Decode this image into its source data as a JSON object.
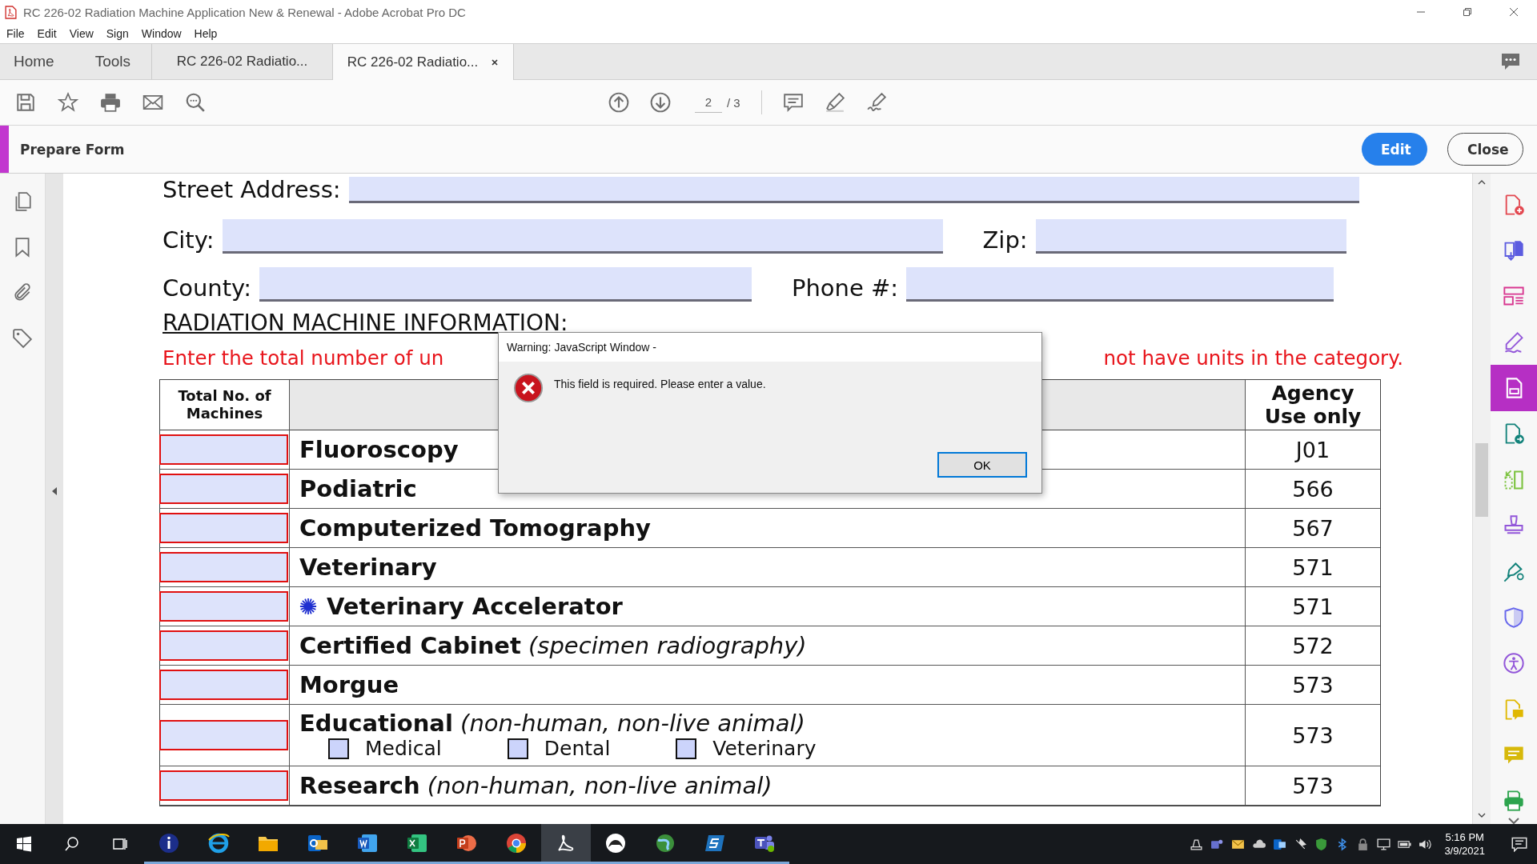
{
  "window": {
    "title": "RC 226-02 Radiation Machine Application New & Renewal - Adobe Acrobat Pro DC"
  },
  "menu": [
    "File",
    "Edit",
    "View",
    "Sign",
    "Window",
    "Help"
  ],
  "nav": [
    "Home",
    "Tools"
  ],
  "tabs": [
    {
      "label": "RC 226-02 Radiatio...",
      "selected": false
    },
    {
      "label": "RC 226-02 Radiatio...",
      "selected": true
    }
  ],
  "toolbar": {
    "page": "2",
    "page_count": "/ 3"
  },
  "panel": {
    "title": "Prepare Form",
    "buttons": [
      {
        "label": "Edit",
        "kind": "primary"
      },
      {
        "label": "Close",
        "kind": "secondary"
      }
    ]
  },
  "right_tools": [
    {
      "kind": "doc-plus",
      "selected": false
    },
    {
      "kind": "doc-down",
      "selected": false
    },
    {
      "kind": "layout",
      "selected": false
    },
    {
      "kind": "pen",
      "selected": false
    },
    {
      "kind": "form",
      "selected": true
    },
    {
      "kind": "doc-arrow",
      "selected": false
    },
    {
      "kind": "crop",
      "selected": false
    },
    {
      "kind": "stamp",
      "selected": false
    },
    {
      "kind": "nib",
      "selected": false
    },
    {
      "kind": "shield",
      "selected": false
    },
    {
      "kind": "access",
      "selected": false
    },
    {
      "kind": "doc-comment",
      "selected": false
    },
    {
      "kind": "comment",
      "selected": false
    },
    {
      "kind": "printer",
      "selected": false
    }
  ],
  "field_rows": [
    {
      "fields": [
        {
          "label": "Street Address:"
        }
      ]
    },
    {
      "fields": [
        {
          "label": "City:"
        },
        {
          "label": "Zip:"
        }
      ]
    },
    {
      "fields": [
        {
          "label": "County:"
        },
        {
          "label": "Phone #:"
        }
      ]
    }
  ],
  "section_heading": "RADIATION MACHINE INFORMATION:",
  "instruction": [
    "Enter the total number of un",
    "not have units in the category."
  ],
  "table": {
    "count_header": "Total No. of Machines",
    "code_header": "Agency Use only",
    "rows": [
      {
        "label": "Fluoroscopy",
        "code": "J01",
        "required": true
      },
      {
        "label": "Podiatric",
        "code": "566",
        "required": true
      },
      {
        "label": "Computerized Tomography",
        "code": "567",
        "required": true
      },
      {
        "label": "Veterinary",
        "code": "571",
        "required": true
      },
      {
        "label": "Veterinary Accelerator",
        "starred": true,
        "code": "571",
        "required": true
      },
      {
        "label": "Certified Cabinet",
        "note": "(specimen radiography)",
        "code": "572",
        "required": true
      },
      {
        "label": "Morgue",
        "code": "573",
        "required": true
      },
      {
        "label": "Educational",
        "note": "(non-human, non-live animal)",
        "code": "573",
        "required": true,
        "options": [
          {
            "label": "Medical",
            "checked": false
          },
          {
            "label": "Dental",
            "checked": false
          },
          {
            "label": "Veterinary",
            "checked": false
          }
        ]
      },
      {
        "label": "Research",
        "note": "(non-human, non-live animal)",
        "code": "573",
        "required": true
      }
    ]
  },
  "dialog": {
    "title": "Warning: JavaScript Window -",
    "message": "This field is required. Please enter a value.",
    "button": "OK"
  },
  "taskbar": {
    "apps": [
      {
        "kind": "info",
        "selected": false
      },
      {
        "kind": "browser",
        "selected": false
      },
      {
        "kind": "folder",
        "selected": false
      },
      {
        "kind": "mail",
        "selected": false
      },
      {
        "kind": "word",
        "selected": false
      },
      {
        "kind": "sheet",
        "selected": false
      },
      {
        "kind": "slides",
        "selected": false
      },
      {
        "kind": "chrome",
        "selected": false
      },
      {
        "kind": "acrobat",
        "selected": true
      },
      {
        "kind": "game",
        "selected": false
      },
      {
        "kind": "globe",
        "selected": false
      },
      {
        "kind": "sync",
        "selected": false
      },
      {
        "kind": "teams",
        "selected": false
      }
    ],
    "time": "5:16 PM",
    "date": "3/9/2021"
  }
}
